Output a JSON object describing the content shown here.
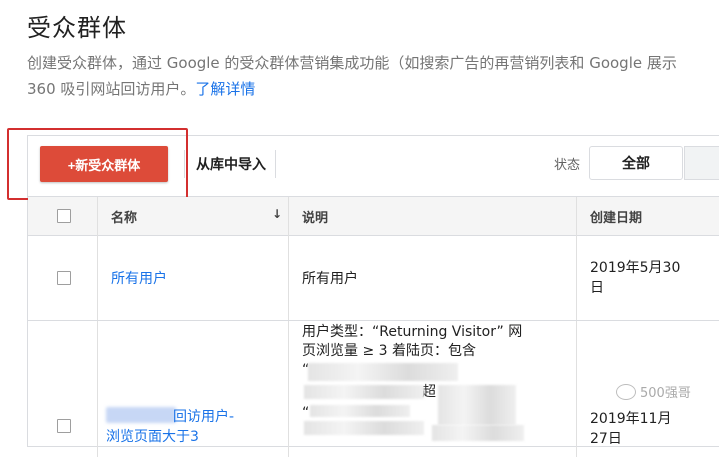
{
  "page": {
    "title": "受众群体",
    "description_line1": "创建受众群体，通过 Google 的受众群体营销集成功能（如搜索广告的再营销列表和 Google 展示",
    "description_line2": "360 吸引网站回访用户。",
    "learn_more": "了解详情"
  },
  "toolbar": {
    "new_audience": "+新受众群体",
    "import_library": "从库中导入",
    "status_label": "状态",
    "status_all": "全部"
  },
  "table": {
    "columns": {
      "name": "名称",
      "sort_icon": "↓",
      "description": "说明",
      "created": "创建日期"
    },
    "rows": [
      {
        "name": "所有用户",
        "description": "所有用户",
        "created_line1": "2019年5月30",
        "created_line2": "日"
      },
      {
        "name_line1": "回访用户-",
        "name_line2": "浏览页面大于3",
        "desc_line1": "用户类型：“Returning Visitor” 网",
        "desc_line2": "页浏览量 ≥ 3 着陆页：包含",
        "desc_quote1": "“",
        "desc_fragment": "超",
        "desc_quote2": "“",
        "created_line1": "2019年11月",
        "created_line2": "27日"
      }
    ]
  },
  "watermark": {
    "text": "500强哥"
  },
  "colors": {
    "primary_red": "#dd4b39",
    "link_blue": "#1a73e8",
    "highlight_red": "#d32f2f"
  }
}
